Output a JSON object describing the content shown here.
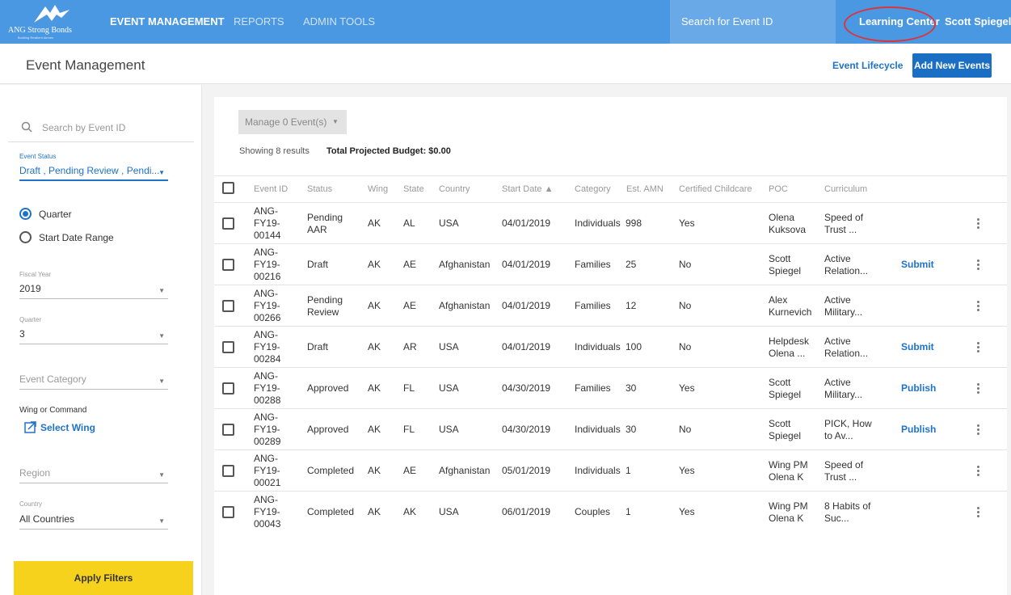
{
  "nav": {
    "logo_text": "ANG Strong Bonds",
    "logo_subtext": "Building Resilient Airmen",
    "items": [
      "EVENT MANAGEMENT",
      "REPORTS",
      "ADMIN TOOLS"
    ],
    "search_label": "Search for Event ID",
    "learning_center": "Learning Center",
    "user": "Scott Spiegel",
    "highlight_color": "#d9363e"
  },
  "header": {
    "title": "Event Management",
    "lifecycle_link": "Event Lifecycle",
    "add_button": "Add New Events"
  },
  "sidebar": {
    "search_placeholder": "Search by Event ID",
    "event_status_label": "Event Status",
    "event_status_value": "Draft , Pending Review , Pendi...",
    "radio_quarter": "Quarter",
    "radio_range": "Start Date Range",
    "fiscal_year_label": "Fiscal Year",
    "fiscal_year_value": "2019",
    "quarter_label": "Quarter",
    "quarter_value": "3",
    "event_category_placeholder": "Event Category",
    "wing_label": "Wing or Command",
    "select_wing": "Select Wing",
    "region_placeholder": "Region",
    "country_label": "Country",
    "country_value": "All Countries",
    "apply_button": "Apply Filters"
  },
  "main": {
    "manage_button": "Manage 0 Event(s)",
    "showing": "Showing 8 results",
    "budget": "Total Projected Budget: $0.00",
    "columns": [
      "Event ID",
      "Status",
      "Wing",
      "State",
      "Country",
      "Start Date ▲",
      "Category",
      "Est. AMN",
      "Certified Childcare",
      "POC",
      "Curriculum"
    ],
    "rows": [
      {
        "id": [
          "ANG-",
          "FY19-",
          "00144"
        ],
        "status": [
          "Pending",
          "AAR"
        ],
        "wing": "AK",
        "state": "AL",
        "country": "USA",
        "date": "04/01/2019",
        "category": "Individuals",
        "amn": "998",
        "childcare": "Yes",
        "poc": [
          "Olena",
          "Kuksova"
        ],
        "curriculum": [
          "Speed of",
          "Trust ..."
        ],
        "action": ""
      },
      {
        "id": [
          "ANG-",
          "FY19-",
          "00216"
        ],
        "status": [
          "Draft"
        ],
        "wing": "AK",
        "state": "AE",
        "country": "Afghanistan",
        "date": "04/01/2019",
        "category": "Families",
        "amn": "25",
        "childcare": "No",
        "poc": [
          "Scott",
          "Spiegel"
        ],
        "curriculum": [
          "Active",
          "Relation..."
        ],
        "action": "Submit"
      },
      {
        "id": [
          "ANG-",
          "FY19-",
          "00266"
        ],
        "status": [
          "Pending",
          "Review"
        ],
        "wing": "AK",
        "state": "AE",
        "country": "Afghanistan",
        "date": "04/01/2019",
        "category": "Families",
        "amn": "12",
        "childcare": "No",
        "poc": [
          "Alex",
          "Kurnevich"
        ],
        "curriculum": [
          "Active",
          "Military..."
        ],
        "action": ""
      },
      {
        "id": [
          "ANG-",
          "FY19-",
          "00284"
        ],
        "status": [
          "Draft"
        ],
        "wing": "AK",
        "state": "AR",
        "country": "USA",
        "date": "04/01/2019",
        "category": "Individuals",
        "amn": "100",
        "childcare": "No",
        "poc": [
          "Helpdesk",
          "Olena ..."
        ],
        "curriculum": [
          "Active",
          "Relation..."
        ],
        "action": "Submit"
      },
      {
        "id": [
          "ANG-",
          "FY19-",
          "00288"
        ],
        "status": [
          "Approved"
        ],
        "wing": "AK",
        "state": "FL",
        "country": "USA",
        "date": "04/30/2019",
        "category": "Families",
        "amn": "30",
        "childcare": "Yes",
        "poc": [
          "Scott",
          "Spiegel"
        ],
        "curriculum": [
          "Active",
          "Military..."
        ],
        "action": "Publish"
      },
      {
        "id": [
          "ANG-",
          "FY19-",
          "00289"
        ],
        "status": [
          "Approved"
        ],
        "wing": "AK",
        "state": "FL",
        "country": "USA",
        "date": "04/30/2019",
        "category": "Individuals",
        "amn": "30",
        "childcare": "No",
        "poc": [
          "Scott",
          "Spiegel"
        ],
        "curriculum": [
          "PICK, How",
          "to Av..."
        ],
        "action": "Publish"
      },
      {
        "id": [
          "ANG-",
          "FY19-",
          "00021"
        ],
        "status": [
          "Completed"
        ],
        "wing": "AK",
        "state": "AE",
        "country": "Afghanistan",
        "date": "05/01/2019",
        "category": "Individuals",
        "amn": "1",
        "childcare": "Yes",
        "poc": [
          "Wing PM",
          "Olena K"
        ],
        "curriculum": [
          "Speed of",
          "Trust ..."
        ],
        "action": ""
      },
      {
        "id": [
          "ANG-",
          "FY19-",
          "00043"
        ],
        "status": [
          "Completed"
        ],
        "wing": "AK",
        "state": "AK",
        "country": "USA",
        "date": "06/01/2019",
        "category": "Couples",
        "amn": "1",
        "childcare": "Yes",
        "poc": [
          "Wing PM",
          "Olena K"
        ],
        "curriculum": [
          "8 Habits of",
          "Suc..."
        ],
        "action": ""
      }
    ]
  }
}
